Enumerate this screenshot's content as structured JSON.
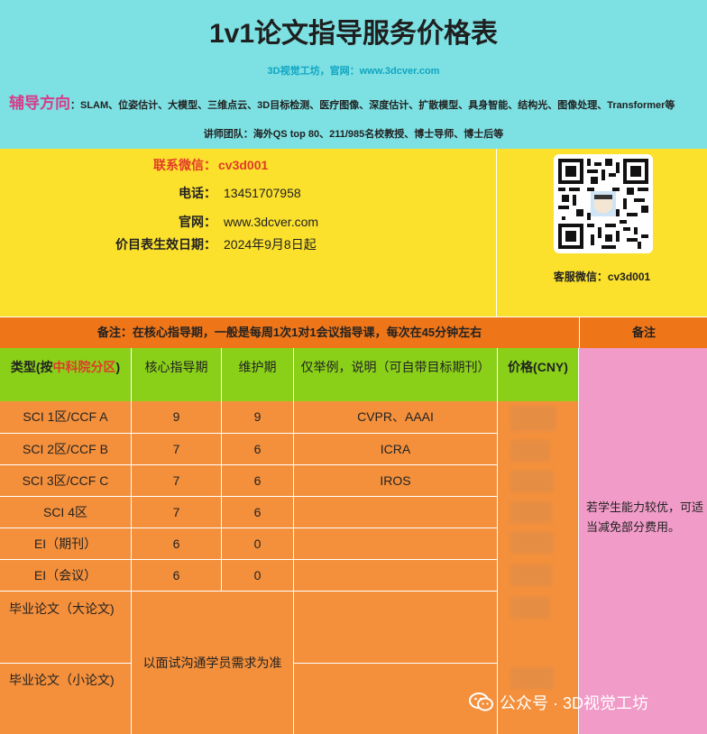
{
  "header": {
    "title": "1v1论文指导服务价格表",
    "subtitle": "3D视觉工坊，官网：www.3dcver.com",
    "direction_label": "辅导方向",
    "direction_text": "：SLAM、位姿估计、大模型、三维点云、3D目标检测、医疗图像、深度估计、扩散模型、具身智能、结构光、图像处理、Transformer等",
    "team": "讲师团队：海外QS top 80、211/985名校教授、博士导师、博士后等"
  },
  "contact": {
    "wechat_label": "联系微信：",
    "wechat_value": "cv3d001",
    "phone_label": "电话：",
    "phone_value": "13451707958",
    "site_label": "官网：",
    "site_value": "www.3dcver.com",
    "date_label": "价目表生效日期：",
    "date_value": "2024年9月8日起",
    "qr_caption": "客服微信：cv3d001"
  },
  "note": {
    "text": "备注：在核心指导期，一般是每周1次1对1会议指导课，每次在45分钟左右",
    "remark_header": "备注",
    "remark_body": "若学生能力较优，可适当减免部分费用。"
  },
  "table": {
    "headers": {
      "type_prefix": "类型(按",
      "type_highlight": "中科院分区",
      "type_suffix": ")",
      "core": "核心指导期",
      "maintain": "维护期",
      "example": "仅举例，说明（可自带目标期刊）",
      "price": "价格(CNY)"
    },
    "rows": [
      {
        "type": "SCI 1区/CCF A",
        "core": "9",
        "maintain": "9",
        "example": "CVPR、AAAI"
      },
      {
        "type": "SCI 2区/CCF B",
        "core": "7",
        "maintain": "6",
        "example": "ICRA"
      },
      {
        "type": "SCI 3区/CCF C",
        "core": "7",
        "maintain": "6",
        "example": "IROS"
      },
      {
        "type": "SCI 4区",
        "core": "7",
        "maintain": "6",
        "example": ""
      },
      {
        "type": "EI（期刊）",
        "core": "6",
        "maintain": "0",
        "example": ""
      },
      {
        "type": "EI（会议）",
        "core": "6",
        "maintain": "0",
        "example": ""
      }
    ],
    "thesis_big": "毕业论文（大论文)",
    "thesis_small": "毕业论文（小论文)",
    "thesis_note": "以面试沟通学员需求为准"
  },
  "watermark": {
    "text": "公众号 · 3D视觉工坊"
  },
  "colors": {
    "header_bg": "#7de0e2",
    "contact_bg": "#fbe02c",
    "note_bg": "#ee7518",
    "table_header_bg": "#8ad019",
    "table_body_bg": "#f4903c",
    "remark_bg": "#f19bc8",
    "accent_red": "#e23a2a",
    "accent_pink": "#d93a8a"
  }
}
